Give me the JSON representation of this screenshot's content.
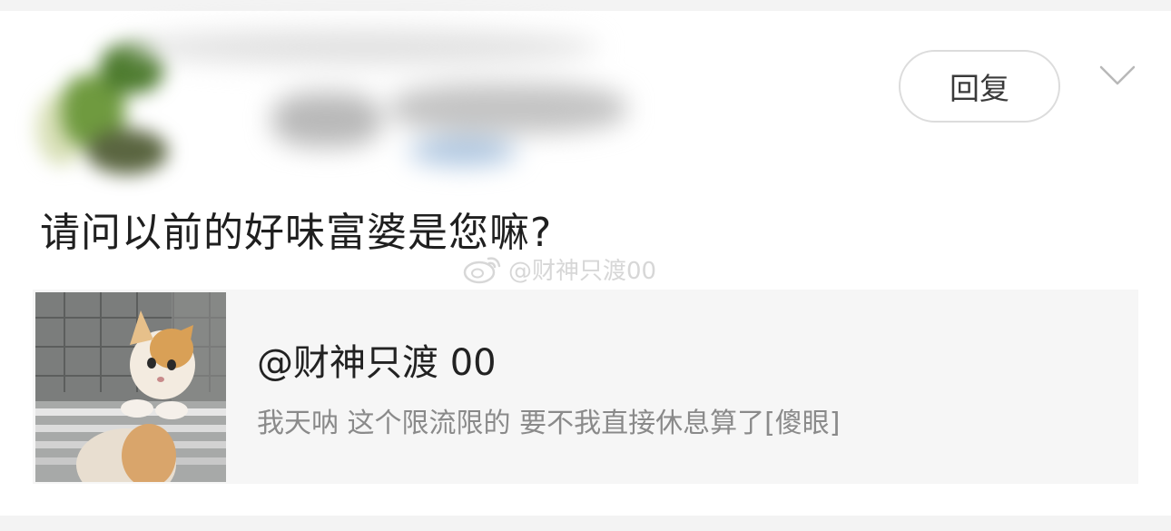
{
  "comment": {
    "reply_label": "回复",
    "text": "请问以前的好味富婆是您嘛?"
  },
  "watermark": {
    "text": "@财神只渡00"
  },
  "quoted": {
    "user": "@财神只渡 00",
    "text": "我天呐 这个限流限的 要不我直接休息算了[傻眼]"
  },
  "icons": {
    "more": "chevron-down-icon",
    "watermark_logo": "weibo-logo-icon"
  },
  "colors": {
    "card_bg": "#ffffff",
    "page_bg": "#f3f3f3",
    "quote_bg": "#f6f6f6",
    "secondary_text": "#8a8a8a"
  }
}
